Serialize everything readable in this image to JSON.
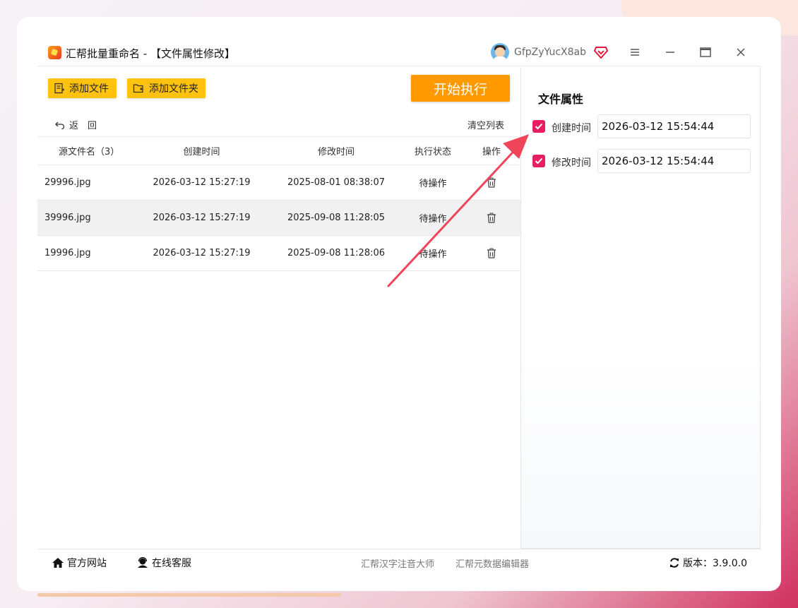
{
  "app": {
    "title": "汇帮批量重命名 - 【文件属性修改】",
    "username": "GfpZyYucX8ab"
  },
  "toolbar": {
    "add_file_label": "添加文件",
    "add_folder_label": "添加文件夹",
    "start_label": "开始执行",
    "back_label": "返　回",
    "clear_label": "清空列表"
  },
  "table": {
    "headers": {
      "name": "源文件名（3）",
      "ctime": "创建时间",
      "mtime": "修改时间",
      "status": "执行状态",
      "op": "操作"
    },
    "rows": [
      {
        "name": "29996.jpg",
        "ctime": "2026-03-12 15:27:19",
        "mtime": "2025-08-01 08:38:07",
        "status": "待操作"
      },
      {
        "name": "39996.jpg",
        "ctime": "2026-03-12 15:27:19",
        "mtime": "2025-09-08 11:28:05",
        "status": "待操作"
      },
      {
        "name": "19996.jpg",
        "ctime": "2026-03-12 15:27:19",
        "mtime": "2025-09-08 11:28:06",
        "status": "待操作"
      }
    ]
  },
  "panel": {
    "title": "文件属性",
    "create_time": {
      "label": "创建时间",
      "checked": true,
      "value": "2026-03-12 15:54:44"
    },
    "modify_time": {
      "label": "修改时间",
      "checked": true,
      "value": "2026-03-12 15:54:44"
    }
  },
  "footer": {
    "website_label": "官方网站",
    "service_label": "在线客服",
    "link1": "汇帮汉字注音大师",
    "link2": "汇帮元数据编辑器",
    "version_label": "版本：3.9.0.0"
  },
  "colors": {
    "accent_yellow": "#ffc20e",
    "start_orange": "#ff9900",
    "checkbox_pink": "#e81e63",
    "arrow_red": "#f0445a"
  }
}
